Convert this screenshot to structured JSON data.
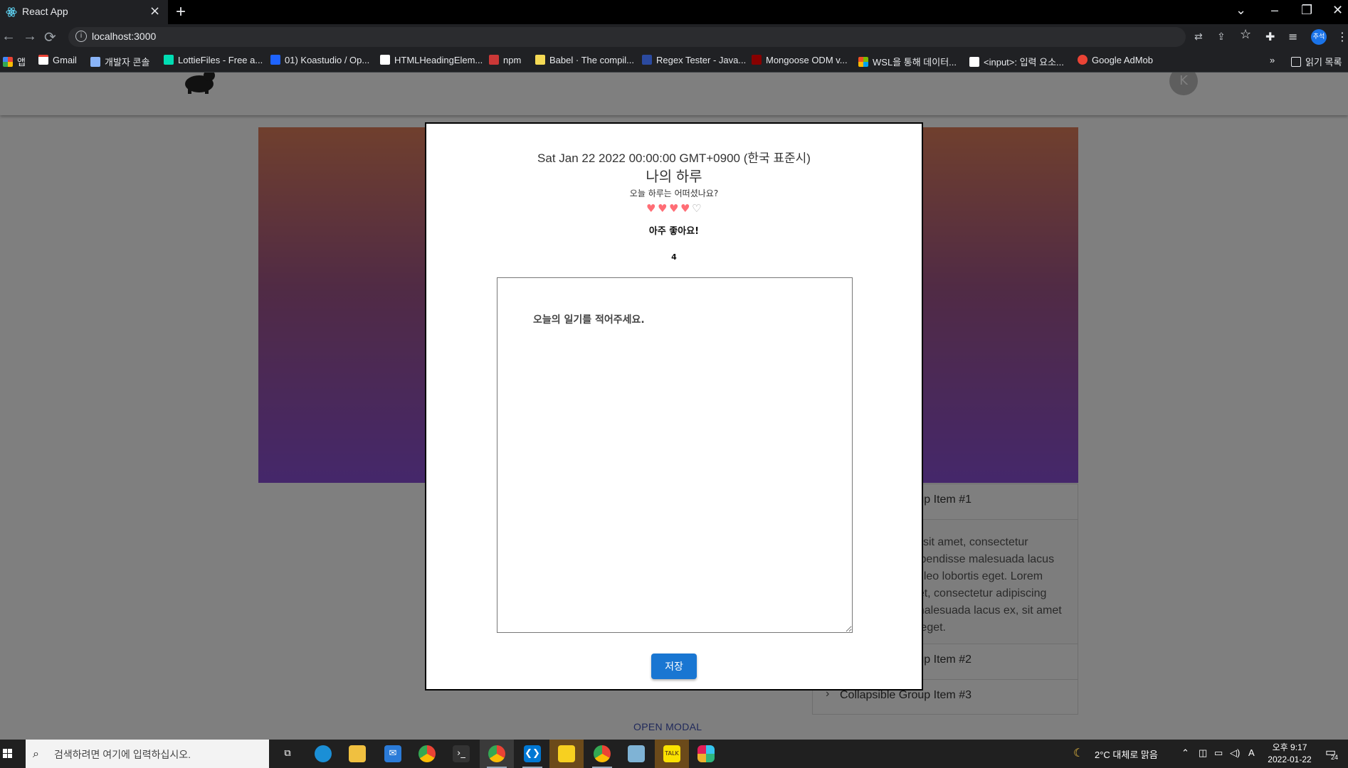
{
  "browser": {
    "tab_title": "React App",
    "url": "localhost:3000",
    "profile_label": "추석",
    "bookmarks": [
      {
        "label": "앱",
        "icon": "apps-grid-icon",
        "color": "#ea4335"
      },
      {
        "label": "Gmail",
        "icon": "gmail-icon",
        "color": "#ea4335"
      },
      {
        "label": "개발자 콘솔",
        "icon": "dev-console-icon",
        "color": "#8ab4f8"
      },
      {
        "label": "LottieFiles - Free a...",
        "icon": "lottie-icon",
        "color": "#00ddb3"
      },
      {
        "label": "01) Koastudio / Op...",
        "icon": "koastudio-icon",
        "color": "#1e63ff"
      },
      {
        "label": "HTMLHeadingElem...",
        "icon": "mdn-icon",
        "color": "#ffffff"
      },
      {
        "label": "npm",
        "icon": "npm-icon",
        "color": "#cb3837"
      },
      {
        "label": "Babel · The compil...",
        "icon": "babel-icon",
        "color": "#f5da55"
      },
      {
        "label": "Regex Tester - Java...",
        "icon": "regex-icon",
        "color": "#2b4aa0"
      },
      {
        "label": "Mongoose ODM v...",
        "icon": "mongoose-icon",
        "color": "#880000"
      },
      {
        "label": "WSL을 통해 데이터...",
        "icon": "microsoft-icon",
        "color": "#f25022"
      },
      {
        "label": "<input>: 입력 요소...",
        "icon": "mdn-icon",
        "color": "#ffffff"
      },
      {
        "label": "Google AdMob",
        "icon": "admob-icon",
        "color": "#ea4335"
      }
    ],
    "reading_list_label": "읽기 목록"
  },
  "page": {
    "avatar_letter": "K",
    "accordion": {
      "item1": "Collapsible Group Item #1",
      "item1_body": "Lorem ipsum dolor sit amet, consectetur adipiscing elit. Suspendisse malesuada lacus ex, sit amet blandit leo lobortis eget. Lorem ipsum dolor sit amet, consectetur adipiscing elit. Suspendisse malesuada lacus ex, sit amet blandit leo lobortis eget.",
      "item2": "Collapsible Group Item #2",
      "item3": "Collapsible Group Item #3"
    },
    "open_modal": "OPEN MODAL"
  },
  "modal": {
    "date": "Sat Jan 22 2022 00:00:00 GMT+0900 (한국 표준시)",
    "title": "나의 하루",
    "question": "오늘 하루는 어떠셨나요?",
    "rating_value": 4,
    "rating_max": 5,
    "rating_text": "아주 좋아요!",
    "rating_number": "4",
    "diary_placeholder": "오늘의 일기를 적어주세요.",
    "save_label": "저장",
    "heart_color": "#ff6d75"
  },
  "taskbar": {
    "search_placeholder": "검색하려면 여기에 입력하십시오.",
    "weather": "2°C  대체로 맑음",
    "ime": "A",
    "time": "오후 9:17",
    "date": "2022-01-22",
    "notification_count": "24"
  }
}
